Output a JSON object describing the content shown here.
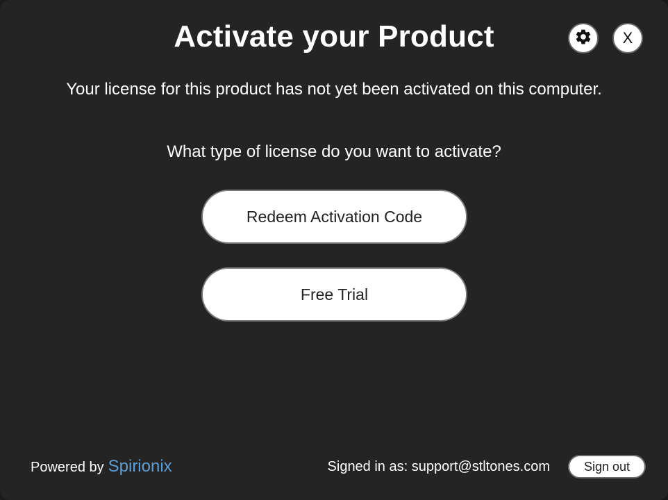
{
  "dialog": {
    "title": "Activate your Product",
    "message": "Your license for this product has not yet been activated on this computer.",
    "question": "What type of license do you want to activate?",
    "close_label": "X"
  },
  "buttons": {
    "redeem_label": "Redeem Activation Code",
    "trial_label": "Free Trial"
  },
  "footer": {
    "powered_by": "Powered by",
    "brand": "Spirionix",
    "signed_in_as": "Signed in as: support@stltones.com",
    "sign_out_label": "Sign out"
  },
  "icons": {
    "settings": "gear-icon",
    "close": "close-icon"
  },
  "colors": {
    "background": "#242424",
    "brand": "#5d9ed6",
    "button": "#ffffff"
  }
}
